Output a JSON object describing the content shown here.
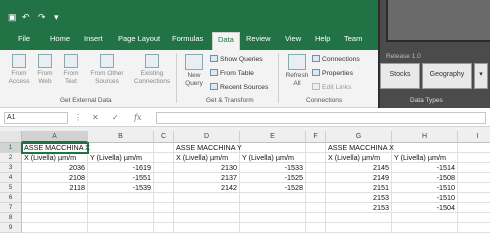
{
  "qat": {
    "save_icon": "save-icon",
    "undo_icon": "undo-icon",
    "redo_icon": "redo-icon",
    "customize_icon": "customize-icon"
  },
  "tabs": [
    "File",
    "Home",
    "Insert",
    "Page Layout",
    "Formulas",
    "Data",
    "Review",
    "View",
    "Help",
    "Team"
  ],
  "active_tab": "Data",
  "ribbon": {
    "get_external": {
      "from_access": "From Access",
      "from_web": "From Web",
      "from_text": "From Text",
      "from_other": "From Other Sources",
      "existing": "Existing Connections",
      "label": "Get External Data"
    },
    "get_transform": {
      "new_query": "New Query",
      "show_queries": "Show Queries",
      "from_table": "From Table",
      "recent_sources": "Recent Sources",
      "label": "Get & Transform"
    },
    "connections": {
      "refresh_all": "Refresh All",
      "connections": "Connections",
      "properties": "Properties",
      "edit_links": "Edit Links",
      "label": "Connections"
    },
    "data_types": {
      "release": "Release 1.0",
      "stocks": "Stocks",
      "geography": "Geography",
      "label": "Data Types"
    }
  },
  "formula_bar": {
    "name_box": "A1",
    "cancel_icon": "cancel-icon",
    "enter_icon": "enter-icon",
    "fx": "fx",
    "formula": ""
  },
  "columns": [
    "A",
    "B",
    "C",
    "D",
    "E",
    "F",
    "G",
    "H",
    "I"
  ],
  "rows": [
    "1",
    "2",
    "3",
    "4",
    "5",
    "6",
    "7",
    "8",
    "9"
  ],
  "cells": {
    "A1": "ASSE MACCHINA X",
    "D1": "ASSE MACCHINA Y",
    "G1": "ASSE MACCHINA X",
    "A2": "X (Livella) µm/m",
    "B2": "Y (Livella) µm/m",
    "D2": "X (Livella) µm/m",
    "E2": "Y (Livella) µm/m",
    "G2": "X (Livella) µm/m",
    "H2": "Y (Livella) µm/m",
    "A3": "2036",
    "B3": "-1619",
    "D3": "2130",
    "E3": "-1533",
    "G3": "2145",
    "H3": "-1514",
    "A4": "2108",
    "B4": "-1551",
    "D4": "2137",
    "E4": "-1525",
    "G4": "2149",
    "H4": "-1508",
    "A5": "2118",
    "B5": "-1539",
    "D5": "2142",
    "E5": "-1528",
    "G5": "2151",
    "H5": "-1510",
    "G6": "2153",
    "H6": "-1510",
    "G7": "2153",
    "H7": "-1504"
  },
  "colors": {
    "accent": "#217346",
    "overlay": "#4b4b4b"
  }
}
